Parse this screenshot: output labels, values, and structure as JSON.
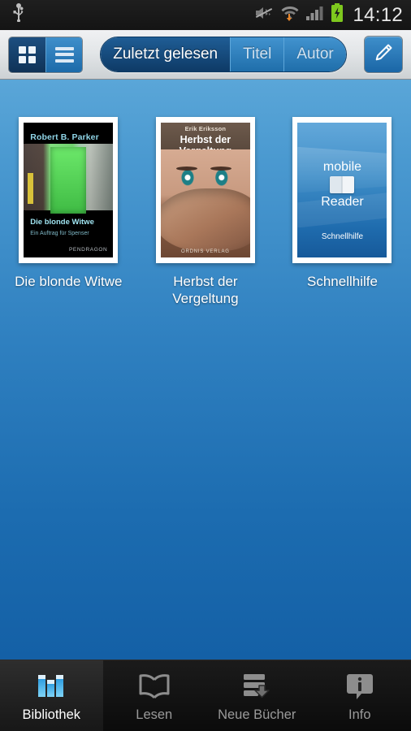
{
  "statusbar": {
    "time": "14:12",
    "icons": [
      "usb-icon",
      "mute-icon",
      "wifi-download-icon",
      "signal-icon",
      "battery-charging-icon"
    ]
  },
  "toolbar": {
    "view_toggle": {
      "grid_label": "grid-view",
      "list_label": "list-view",
      "selected": "grid"
    },
    "sort_segments": [
      {
        "label": "Zuletzt gelesen",
        "selected": true
      },
      {
        "label": "Titel",
        "selected": false
      },
      {
        "label": "Autor",
        "selected": false
      }
    ],
    "edit_label": "edit-pencil"
  },
  "library": {
    "books": [
      {
        "title": "Die blonde Witwe",
        "cover": {
          "author": "Robert B. Parker",
          "title": "Die blonde Witwe",
          "subtitle": "Ein Auftrag für Spenser",
          "publisher": "PENDRAGON"
        }
      },
      {
        "title": "Herbst der Vergeltung",
        "cover": {
          "author": "Erik Eriksson",
          "title": "Herbst der Vergeltung",
          "publisher": "ORDNIS VERLAG"
        }
      },
      {
        "title": "Schnellhilfe",
        "cover": {
          "brand_top": "mobile",
          "brand_bottom": "Reader",
          "caption": "Schnellhilfe"
        }
      }
    ]
  },
  "bottom_nav": {
    "items": [
      {
        "label": "Bibliothek",
        "icon": "books-icon",
        "active": true
      },
      {
        "label": "Lesen",
        "icon": "open-book-icon",
        "active": false
      },
      {
        "label": "Neue Bücher",
        "icon": "download-books-icon",
        "active": false
      },
      {
        "label": "Info",
        "icon": "info-bubble-icon",
        "active": false
      }
    ]
  },
  "colors": {
    "accent_blue": "#1f6eaa",
    "shelf_top": "#5aa6d8",
    "shelf_bottom": "#1460a6",
    "nav_active_text": "#ffffff",
    "nav_text": "#9a9a9a"
  }
}
